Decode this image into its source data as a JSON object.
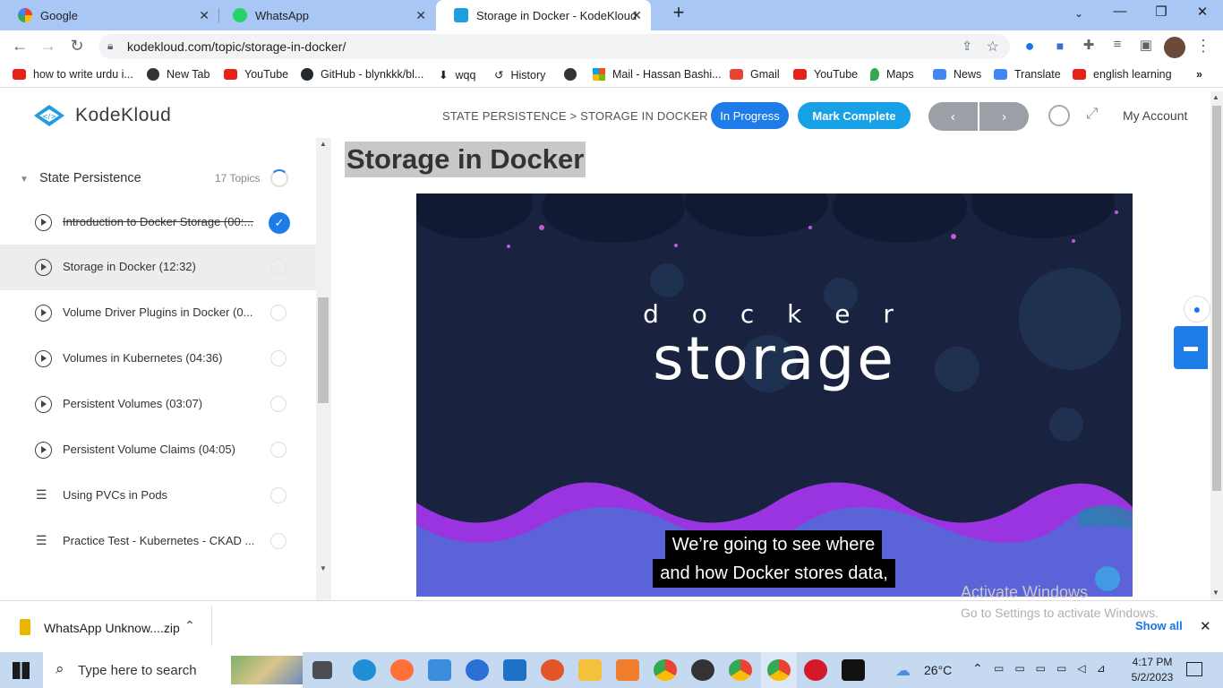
{
  "browser": {
    "tabs": [
      {
        "label": "Google"
      },
      {
        "label": "WhatsApp"
      },
      {
        "label": "Storage in Docker - KodeKloud"
      }
    ],
    "url": "kodekloud.com/topic/storage-in-docker/",
    "bookmarks": [
      "how to write urdu i...",
      "New Tab",
      "YouTube",
      "GitHub - blynkkk/bl...",
      "wqq",
      "History",
      "Mail - Hassan Bashi...",
      "Gmail",
      "YouTube",
      "Maps",
      "News",
      "Translate",
      "english learning"
    ]
  },
  "header": {
    "logo": "KodeKloud",
    "breadcrumb": "STATE PERSISTENCE > STORAGE IN DOCKER",
    "status": "In Progress",
    "mark_complete": "Mark Complete",
    "account": "My Account"
  },
  "sidebar": {
    "section_title": "State Persistence",
    "section_count": "17 Topics",
    "lessons": [
      {
        "title": "Introduction to Docker Storage (00:...",
        "completed": true,
        "type": "video"
      },
      {
        "title": "Storage in Docker (12:32)",
        "completed": false,
        "type": "video"
      },
      {
        "title": "Volume Driver Plugins in Docker (0...",
        "completed": false,
        "type": "video"
      },
      {
        "title": "Volumes in Kubernetes (04:36)",
        "completed": false,
        "type": "video"
      },
      {
        "title": "Persistent Volumes (03:07)",
        "completed": false,
        "type": "video"
      },
      {
        "title": "Persistent Volume Claims (04:05)",
        "completed": false,
        "type": "video"
      },
      {
        "title": "Using PVCs in Pods",
        "completed": false,
        "type": "doc"
      },
      {
        "title": "Practice Test - Kubernetes - CKAD ...",
        "completed": false,
        "type": "doc"
      }
    ]
  },
  "main": {
    "title": "Storage in Docker",
    "video": {
      "word1": "d o c k e r",
      "word2": "storage",
      "caption_line1": "We’re going to see where",
      "caption_line2": "and how Docker stores data,"
    },
    "watermark_line1": "Activate Windows",
    "watermark_line2": "Go to Settings to activate Windows."
  },
  "download": {
    "file": "WhatsApp Unknow....zip",
    "show_all": "Show all"
  },
  "taskbar": {
    "search_placeholder": "Type here to search",
    "weather": "26°C",
    "time": "4:17 PM",
    "date": "5/2/2023"
  }
}
